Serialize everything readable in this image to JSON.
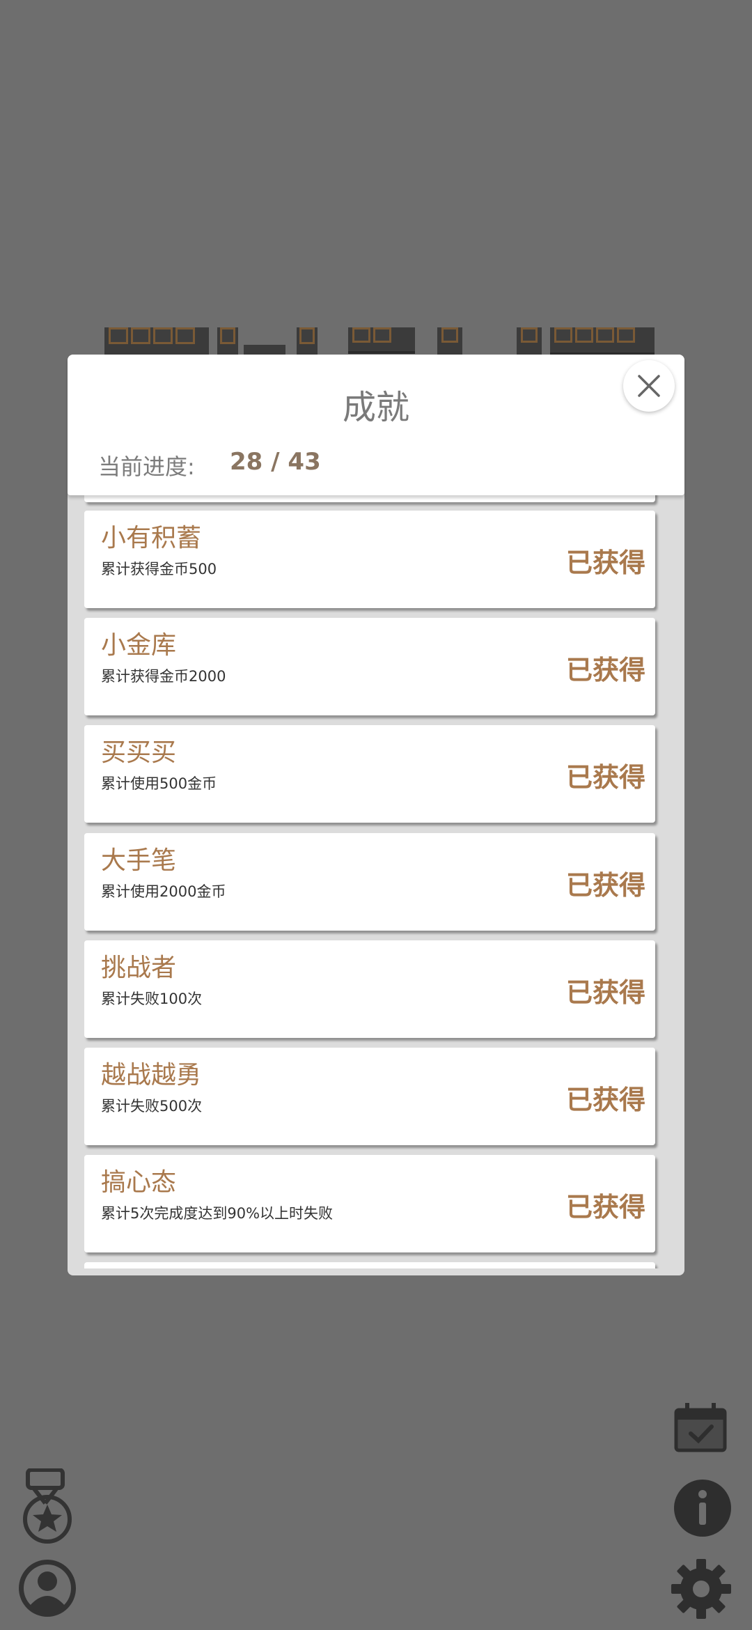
{
  "modal": {
    "title": "成就",
    "progress_label": "当前进度:",
    "progress_value": "28 / 43"
  },
  "achievements": [
    {
      "name": "小有积蓄",
      "desc": "累计获得金币500",
      "status": "已获得"
    },
    {
      "name": "小金库",
      "desc": "累计获得金币2000",
      "status": "已获得"
    },
    {
      "name": "买买买",
      "desc": "累计使用500金币",
      "status": "已获得"
    },
    {
      "name": "大手笔",
      "desc": "累计使用2000金币",
      "status": "已获得"
    },
    {
      "name": "挑战者",
      "desc": "累计失败100次",
      "status": "已获得"
    },
    {
      "name": "越战越勇",
      "desc": "累计失败500次",
      "status": "已获得"
    },
    {
      "name": "搞心态",
      "desc": "累计5次完成度达到90%以上时失败",
      "status": "已获得"
    }
  ],
  "icons": {
    "close": "close-icon",
    "achievement": "medal-icon",
    "profile": "user-icon",
    "calendar": "calendar-check-icon",
    "info": "info-icon",
    "settings": "gear-icon"
  },
  "colors": {
    "background": "#6e6e6e",
    "accent": "#a9794d",
    "progress": "#8a7561"
  }
}
